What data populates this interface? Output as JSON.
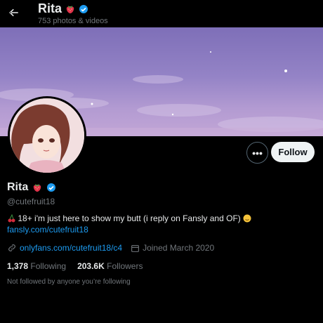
{
  "header": {
    "name": "Rita",
    "post_count": "753 photos & videos"
  },
  "profile": {
    "name": "Rita",
    "handle": "@cutefruit18",
    "bio_text": "18+ i'm just here to show my butt (i reply on Fansly and OF)",
    "bio_link": "fansly.com/cutefruit18",
    "website": "onlyfans.com/cutefruit18/c4",
    "joined": "Joined March 2020",
    "following_count": "1,378",
    "following_label": "Following",
    "followers_count": "203.6K",
    "followers_label": "Followers",
    "not_followed": "Not followed by anyone you’re following"
  },
  "actions": {
    "follow_label": "Follow",
    "more_label": "•••"
  },
  "colors": {
    "accent": "#1d9bf0",
    "verified": "#1d9bf0",
    "background": "#000000"
  },
  "icons": [
    "back-arrow-icon",
    "strawberry-emoji-icon",
    "verified-badge-icon",
    "more-icon",
    "cherry-emoji-icon",
    "smile-emoji-icon",
    "link-icon",
    "calendar-icon"
  ]
}
